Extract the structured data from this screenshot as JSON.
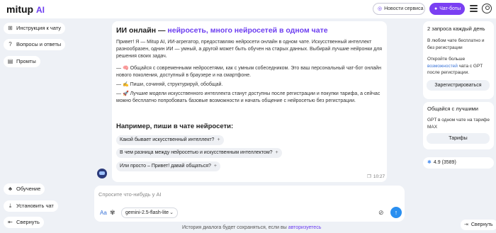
{
  "header": {
    "logo_text": "mitup",
    "logo_ai": "AI",
    "news_label": "Новости сервиса",
    "bots_label": "Чат-боты"
  },
  "left": {
    "items": [
      {
        "label": "Инструкция к чату"
      },
      {
        "label": "Вопросы и ответы"
      },
      {
        "label": "Промты"
      }
    ],
    "learning_label": "Обучение",
    "install_label": "Установить чат",
    "collapse_label": "Свернуть"
  },
  "chat": {
    "title_plain": "ИИ онлайн — ",
    "title_highlight": "нейросеть, много нейросетей в одном чате",
    "intro": "Привет! Я — Mitup AI, ИИ-агрегатор, предоставляю нейросети онлайн в одном чате. Искусственный интеллект разнообразен, однин ИИ — умный, а другой может быть обучен на старых данных. Выбирай лучшие нейронки для решения своих задач.",
    "bullets": [
      "— 🧠 Общайся с современными нейросетями, как с умным собеседником. Это ваш персональный чат-бот онлайн нового поколения, доступный в браузере и на смартфоне.",
      "— ✍️ Пиши, сочиняй, структурируй, обобщай.",
      "— 🚀 Лучшие модели искусственного интеллекта станут доступны после регистрации и покупки тарифа, а сейчас можно бесплатно попробовать базовые возможности и начать общение с нейросетью без регистрации."
    ],
    "examples_title": "Например, пиши в чате нейросети:",
    "examples": [
      "Какой бывает искусственный интеллект?",
      "В чем разница между нейросетью и искусственным интеллектом?",
      "Или просто – Привет! давай общаться?"
    ],
    "time": "10:27"
  },
  "composer": {
    "placeholder": "Спросите что-нибудь у AI",
    "aa_label": "Aa",
    "model": "gemini-2.5-flash-lite"
  },
  "footer": {
    "note": "История диалога будет сохраняться, если вы ",
    "link": "авторизуетесь"
  },
  "right": {
    "free_title": "2 запроса каждый день",
    "free_text": "В любом чате бесплатно и без регистрации",
    "more_text_a": "Откройте больше ",
    "more_link": "возможностей",
    "more_text_b": " чата с GPT после регистрации.",
    "register_label": "Зарегистрироваться",
    "best_title": "Общайся с лучшими",
    "best_text": "GPT в одном чате на тарифе MAX",
    "tariffs_label": "Тарифы",
    "rating": "4.9 (3589)",
    "collapse_label": "Свернуть"
  }
}
